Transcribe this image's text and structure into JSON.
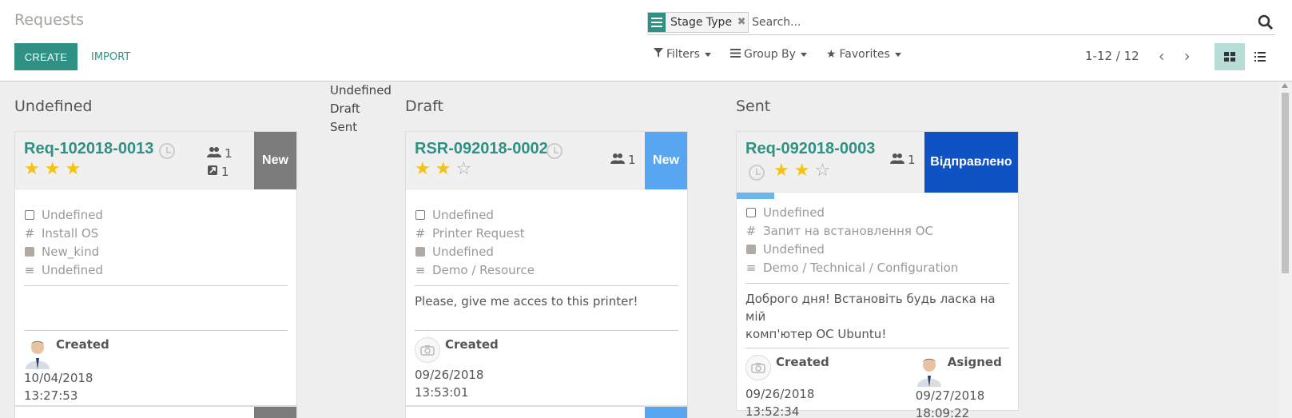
{
  "header": {
    "title": "Requests",
    "create_label": "CREATE",
    "import_label": "IMPORT"
  },
  "search": {
    "facet_label": "Stage Type",
    "placeholder": "Search..."
  },
  "toolbar": {
    "filters_label": "Filters",
    "groupby_label": "Group By",
    "favorites_label": "Favorites",
    "pager": "1-12 / 12"
  },
  "stage_list": [
    "Undefined",
    "Draft",
    "Sent"
  ],
  "columns": [
    {
      "title": "Undefined",
      "card": {
        "ref": "Req-102018-0013",
        "stars": 3,
        "followers": "1",
        "links": "1",
        "badge": "New",
        "badge_color": "#7c7c7c",
        "fields": [
          "Undefined",
          "Install OS",
          "New_kind",
          "Undefined"
        ],
        "description": "",
        "created_label": "Created",
        "created_date": "10/04/2018",
        "created_time": "13:27:53"
      }
    },
    {
      "title": "Draft",
      "card": {
        "ref": "RSR-092018-0002",
        "stars": 2,
        "followers": "1",
        "badge": "New",
        "badge_color": "#58a6f2",
        "fields": [
          "Undefined",
          "Printer Request",
          "Undefined",
          "Demo / Resource"
        ],
        "description": "Please, give me acces to this printer!",
        "created_label": "Created",
        "created_date": "09/26/2018",
        "created_time": "13:53:01"
      }
    },
    {
      "title": "Sent",
      "card": {
        "ref": "Req-092018-0003",
        "stars": 2,
        "followers": "1",
        "badge": "Відправлено",
        "badge_color": "#0f52c4",
        "progress": 0.15,
        "fields": [
          "Undefined",
          "Запит на встановлення ОС",
          "Undefined",
          "Demo / Technical / Configuration"
        ],
        "description_1": "Доброго дня! Встановіть будь ласка на мій",
        "description_2": "комп'ютер ОС Ubuntu!",
        "created_label": "Created",
        "created_date": "09/26/2018",
        "created_time": "13:52:34",
        "assigned_label": "Asigned",
        "assigned_date": "09/27/2018",
        "assigned_time": "18:09:22"
      }
    }
  ]
}
